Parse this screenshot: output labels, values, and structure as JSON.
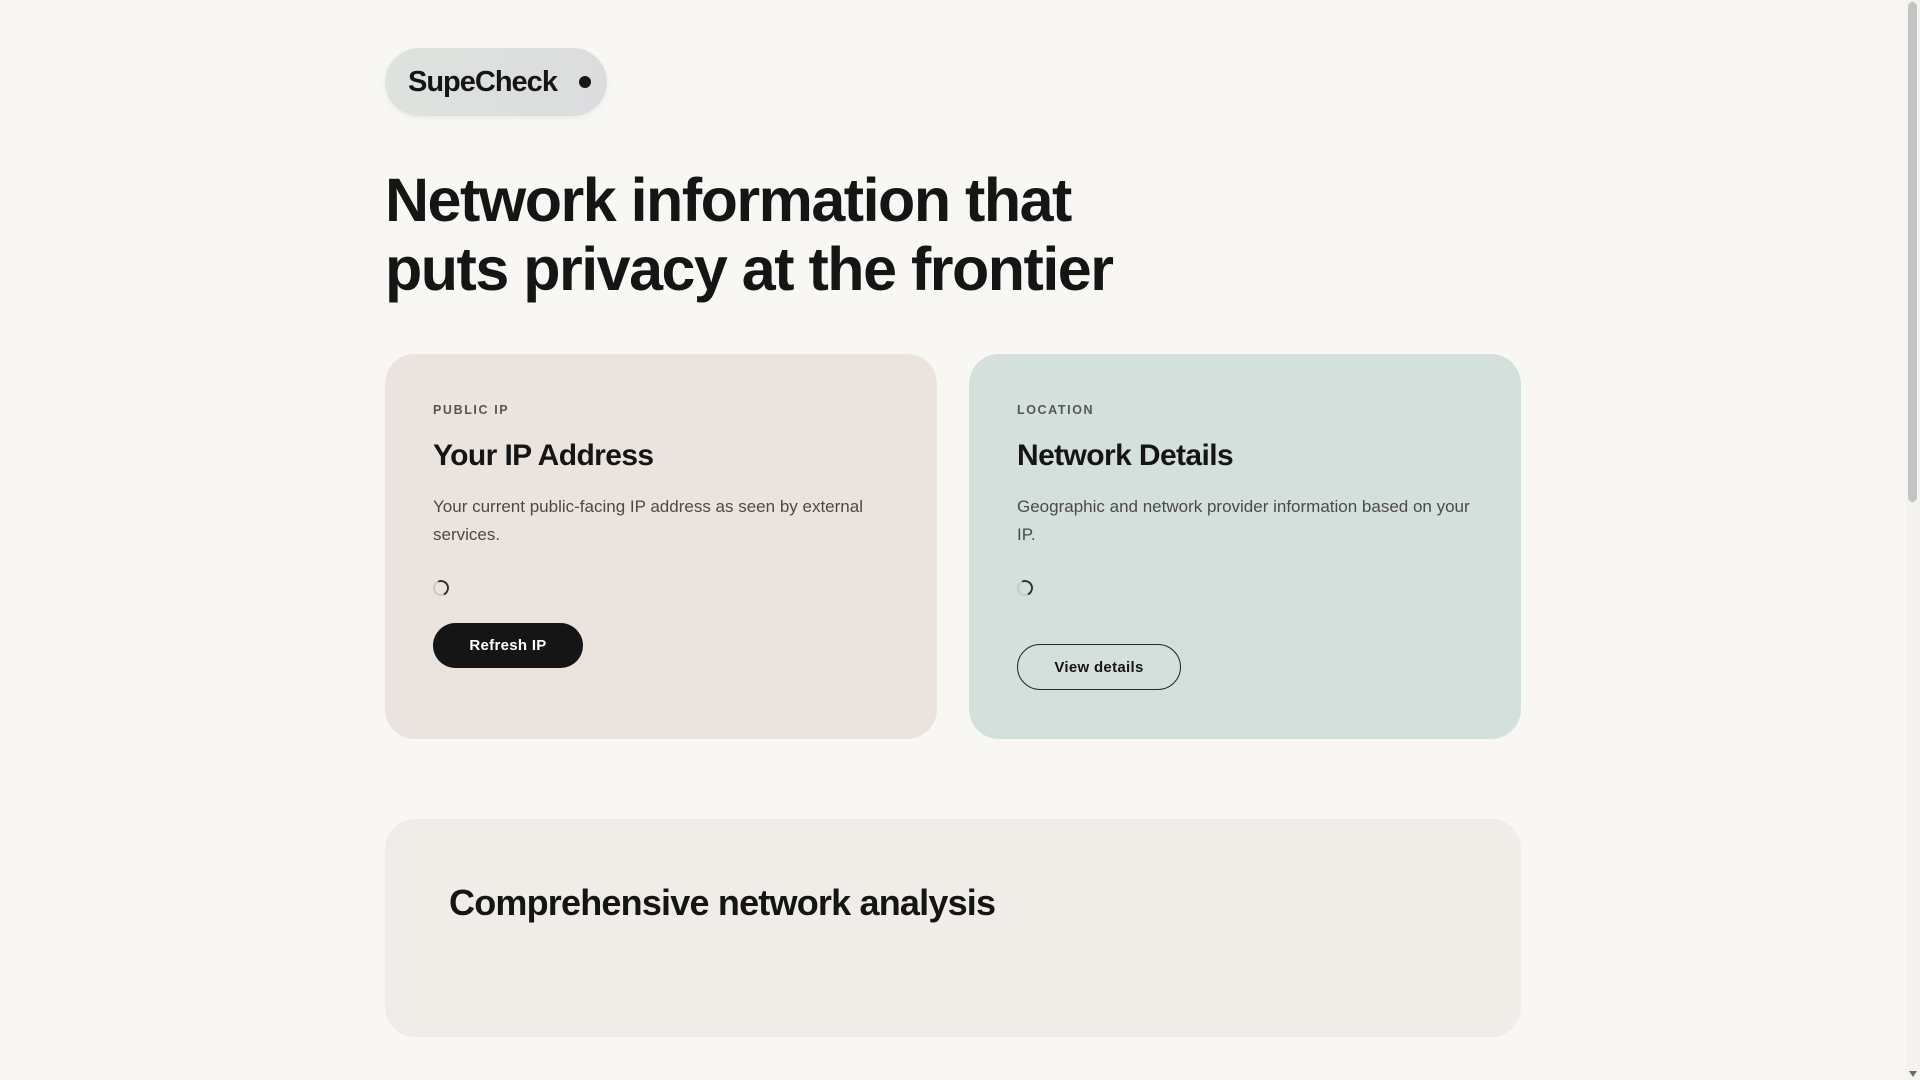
{
  "brand": {
    "name": "SupeCheck",
    "status_icon": "status-dot-icon"
  },
  "hero": {
    "title": "Network information that puts privacy at the frontier"
  },
  "cards": {
    "ip": {
      "eyebrow": "PUBLIC IP",
      "title": "Your IP Address",
      "description": "Your current public-facing IP address as seen by external services.",
      "button_label": "Refresh IP",
      "background": "#ebe3dd"
    },
    "location": {
      "eyebrow": "LOCATION",
      "title": "Network Details",
      "description": "Geographic and network provider information based on your IP.",
      "button_label": "View details",
      "background": "#d4e0dc"
    }
  },
  "analysis": {
    "title": "Comprehensive network analysis"
  },
  "colors": {
    "page_background": "#f8f7f3",
    "text_primary": "#151515",
    "button_primary": "#151515"
  }
}
